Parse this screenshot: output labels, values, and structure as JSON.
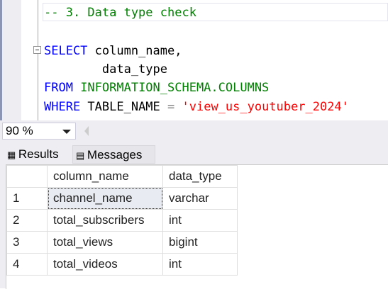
{
  "editor": {
    "comment": "-- 3. Data type check",
    "l1_kw": "SELECT",
    "l1_rest": " column_name,",
    "l2": "        data_type",
    "l3_kw": "FROM",
    "l3_obj": " INFORMATION_SCHEMA.COLUMNS",
    "l4_kw": "WHERE",
    "l4_mid": " TABLE_NAME ",
    "l4_op": "=",
    "l4_str": " 'view_us_youtuber_2024'"
  },
  "zoom": {
    "value": "90 %"
  },
  "tabs": {
    "results": "Results",
    "messages": "Messages"
  },
  "grid": {
    "headers": [
      "column_name",
      "data_type"
    ],
    "rows": [
      {
        "n": "1",
        "name": "channel_name",
        "type": "varchar"
      },
      {
        "n": "2",
        "name": "total_subscribers",
        "type": "int"
      },
      {
        "n": "3",
        "name": "total_views",
        "type": "bigint"
      },
      {
        "n": "4",
        "name": "total_videos",
        "type": "int"
      }
    ]
  }
}
